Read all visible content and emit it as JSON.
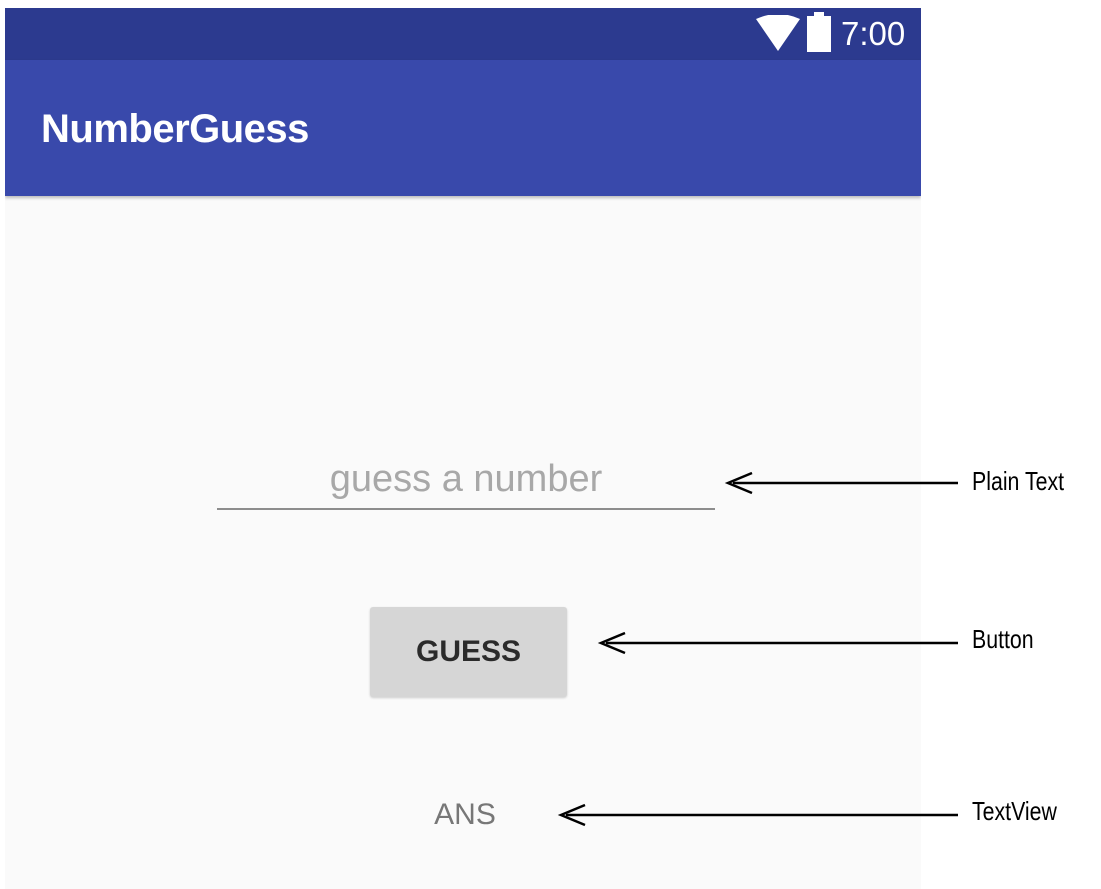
{
  "status_bar": {
    "time": "7:00",
    "icons": [
      "wifi-icon",
      "battery-icon"
    ],
    "background": "#2c3a8f"
  },
  "app_bar": {
    "title": "NumberGuess",
    "background": "#3949ab"
  },
  "main": {
    "input": {
      "placeholder": "guess a number",
      "value": ""
    },
    "button": {
      "label": "GUESS"
    },
    "answer": {
      "text": "ANS"
    }
  },
  "annotations": [
    {
      "label": "Plain Text",
      "target": "guess-input"
    },
    {
      "label": "Button",
      "target": "guess-button"
    },
    {
      "label": "TextView",
      "target": "ans-text"
    }
  ]
}
